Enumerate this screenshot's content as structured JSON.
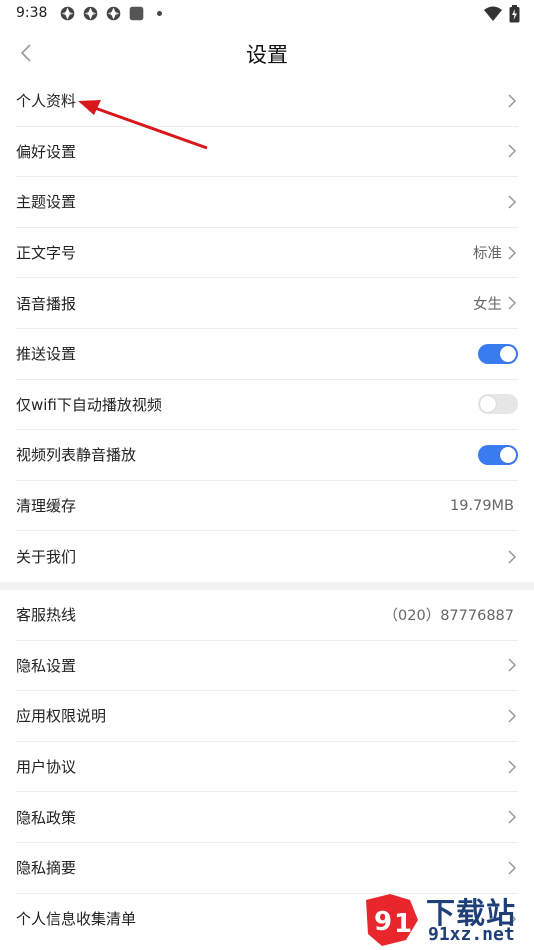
{
  "status_bar": {
    "time": "9:38",
    "icons_left": [
      "app-notification-icon",
      "app-notification-icon",
      "app-notification-icon",
      "square-app-icon",
      "dot-icon"
    ],
    "icons_right": [
      "wifi-icon",
      "battery-icon"
    ]
  },
  "header": {
    "title": "设置",
    "back_icon": "chevron-left-icon"
  },
  "group1": [
    {
      "label": "个人资料",
      "type": "chevron"
    },
    {
      "label": "偏好设置",
      "type": "chevron"
    },
    {
      "label": "主题设置",
      "type": "chevron"
    },
    {
      "label": "正文字号",
      "type": "value-chevron",
      "value": "标准"
    },
    {
      "label": "语音播报",
      "type": "value-chevron",
      "value": "女生"
    },
    {
      "label": "推送设置",
      "type": "toggle",
      "on": true
    },
    {
      "label": "仅wifi下自动播放视频",
      "type": "toggle",
      "on": false
    },
    {
      "label": "视频列表静音播放",
      "type": "toggle",
      "on": true
    },
    {
      "label": "清理缓存",
      "type": "value",
      "value": "19.79MB"
    },
    {
      "label": "关于我们",
      "type": "chevron"
    }
  ],
  "group2": [
    {
      "label": "客服热线",
      "type": "value",
      "value": "（020）87776887"
    },
    {
      "label": "隐私设置",
      "type": "chevron"
    },
    {
      "label": "应用权限说明",
      "type": "chevron"
    },
    {
      "label": "用户协议",
      "type": "chevron"
    },
    {
      "label": "隐私政策",
      "type": "chevron"
    },
    {
      "label": "隐私摘要",
      "type": "chevron"
    },
    {
      "label": "个人信息收集清单",
      "type": "chevron"
    }
  ],
  "colors": {
    "toggle_on": "#3a7bf0",
    "toggle_off": "#e6e6e6",
    "annotation_arrow": "#d9161b",
    "watermark_red": "#e8262b",
    "watermark_blue": "#1f3f78"
  },
  "watermark": {
    "line1": "下载站",
    "line2": "91xz.net",
    "logo_icon": "91-logo-icon"
  }
}
